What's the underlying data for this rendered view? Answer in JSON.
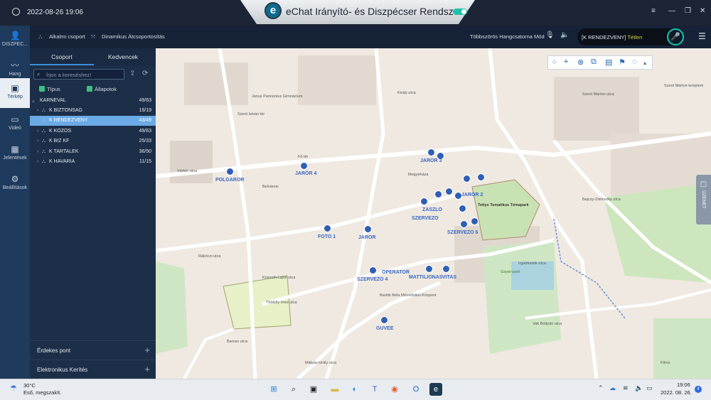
{
  "window": {
    "title": "eChat Irányító-  és Diszpécser Rendszer",
    "datetime": "2022-08-26 19:06",
    "logo_letter": "e",
    "buttons": [
      "≡",
      "—",
      "❐",
      "✕"
    ]
  },
  "rail": {
    "items": [
      {
        "label": "DISZPEC...",
        "icon": "person-icon"
      },
      {
        "label": "Hang",
        "icon": "waveform-icon"
      },
      {
        "label": "Térkép",
        "icon": "map-icon",
        "active": true
      },
      {
        "label": "Videó",
        "icon": "video-icon"
      },
      {
        "label": "Jelentések",
        "icon": "grid-icon"
      },
      {
        "label": "Beállítások",
        "icon": "gear-icon"
      }
    ]
  },
  "toolbar": {
    "adhoc_group": "Alkalmi csoport",
    "dynamic_regroup": "Dinamikus Átcsoportosítás",
    "multichannel": "Többszörös Hangcsatorna Mód",
    "ptt_group": "[K RENDEZVENY]",
    "ptt_status": "Tétlen"
  },
  "panel": {
    "tabs": [
      "Csoport",
      "Kedvencek"
    ],
    "search_placeholder": "Írjon a kereséshez!",
    "filters": [
      "Típus",
      "Állapotok"
    ],
    "root": {
      "name": "KARNEVAL",
      "count": "49/63"
    },
    "groups": [
      {
        "name": "K BIZTONSAG",
        "count": "19/19",
        "selected": false
      },
      {
        "name": "K RENDEZVENY",
        "count": "43/49",
        "selected": true
      },
      {
        "name": "K KOZOS",
        "count": "49/63",
        "selected": false
      },
      {
        "name": "K BIZ KF",
        "count": "25/33",
        "selected": false
      },
      {
        "name": "K TARTALEK",
        "count": "36/50",
        "selected": false
      },
      {
        "name": "K HAVARIA",
        "count": "11/15",
        "selected": false
      }
    ],
    "sections": [
      "Érdekes pont",
      "Elektronikus Kerítés"
    ]
  },
  "map": {
    "unit_labels": [
      "POLGAROR",
      "JARÓR 4",
      "JAROR 3",
      "FOTO 1",
      "JAROR",
      "OPERATOR",
      "SZERVEZO 4",
      "SZERVEZO",
      "GUVEE",
      "ZASZLO",
      "MATTI",
      "LIONAS",
      "VITAS",
      "SZERVEZO 6",
      "JAROR 2"
    ],
    "street_labels": [
      "Fő tér",
      "Belvárosi",
      "Szent Márton utca",
      "Thököly Imre utca",
      "Király utca",
      "Kossuth Lajos utca",
      "Irgalmasok utca",
      "Rákóczi utca",
      "Vak Bottyán utca",
      "Mátyás király utca",
      "Bajcsy-Zsilinszky utca",
      "Szent István tér",
      "Várkör utca",
      "Baross utca"
    ],
    "poi_labels": [
      "Tettye Tematikus Témapark",
      "Gayer-park",
      "Szent Márton templom",
      "Bartók Béla Művelődési Központ",
      "Janus Pannonius Gimnázium",
      "Megyeháza",
      "Főnix"
    ],
    "side_tab": "ÜZENET"
  },
  "taskbar": {
    "temperature": "30°C",
    "weather": "Eső, megszakít.",
    "time": "19:06",
    "date": "2022. 08. 26.",
    "notification_count": "4"
  },
  "colors": {
    "accent": "#3a8fd9",
    "selected": "#6aaae6",
    "rail": "#1e3a5c",
    "pin": "#2f5fb3"
  }
}
